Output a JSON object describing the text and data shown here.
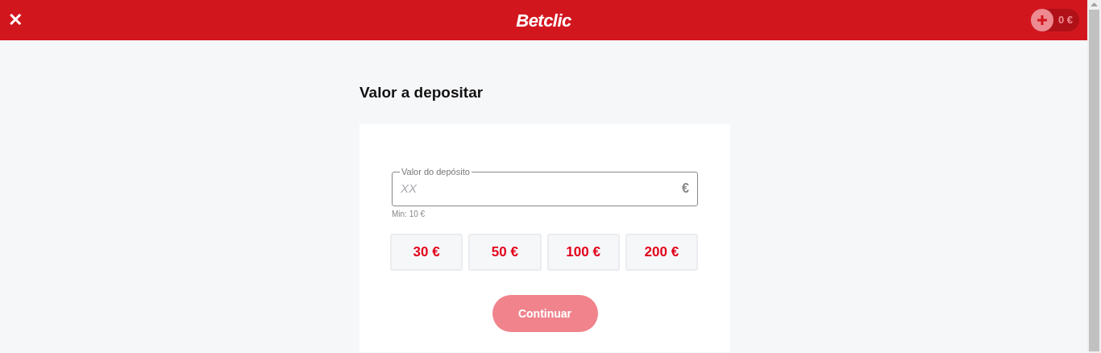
{
  "header": {
    "close_icon": "✕",
    "logo": "Betclic",
    "balance": "0 €"
  },
  "title": "Valor a depositar",
  "deposit_field": {
    "label": "Valor do depósito",
    "placeholder": "XX",
    "currency": "€",
    "hint": "Min: 10 €"
  },
  "amounts": [
    {
      "label": "30 €"
    },
    {
      "label": "50 €"
    },
    {
      "label": "100 €"
    },
    {
      "label": "200 €"
    }
  ],
  "continue_button": {
    "label": "Continuar",
    "disabled": true
  }
}
